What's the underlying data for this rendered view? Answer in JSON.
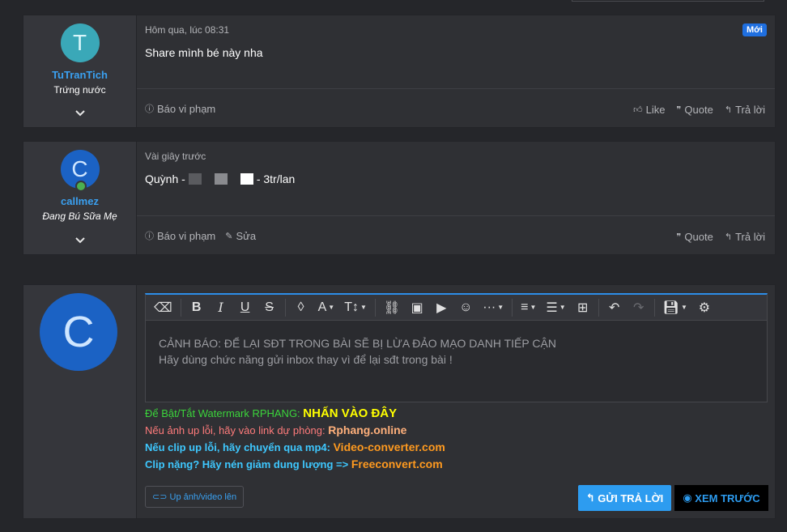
{
  "posts": [
    {
      "avatar_letter": "T",
      "avatar_color": "#3aa8b8",
      "username": "TuTranTich",
      "user_title": "Trứng nước",
      "time": "Hôm qua, lúc 08:31",
      "badge": "Mới",
      "message": "Share mình bé này nha",
      "actions_left": [
        "Báo vi phạm"
      ],
      "actions_right": [
        "Like",
        "Quote",
        "Trả lời"
      ]
    },
    {
      "avatar_letter": "C",
      "avatar_color": "#1b62c4",
      "username": "callmez",
      "user_title": "Đang Bú Sữa Mẹ",
      "time": "Vài giây trước",
      "message_prefix": "Quỳnh -",
      "message_suffix": "- 3tr/lan",
      "actions_left": [
        "Báo vi phạm",
        "Sửa"
      ],
      "actions_right": [
        "Quote",
        "Trả lời"
      ]
    }
  ],
  "reply": {
    "avatar_letter": "C",
    "editor_placeholder_line1": "CẢNH BÁO: ĐỂ LẠI SĐT TRONG BÀI SẼ BỊ LỪA ĐẢO MẠO DANH TIẾP CẬN",
    "editor_placeholder_line2": "Hãy dùng chức năng gửi inbox thay vì để lại sđt trong bài !",
    "notes": [
      {
        "text": "Để Bật/Tắt Watermark RPHANG: ",
        "link": "NHẤN VÀO ĐÂY",
        "color": "#3bd43b",
        "link_color": "#ffff00"
      },
      {
        "text": "Nếu ảnh up lỗi, hãy vào link dự phòng: ",
        "link": "Rphang.online",
        "color": "#ff7b7b",
        "link_color": "#ffb07b"
      },
      {
        "text": "Nếu clip up lỗi, hãy chuyển qua mp4: ",
        "link": "Video-converter.com",
        "color": "#3ec8ff",
        "link_color": "#ff9a1f"
      },
      {
        "text": "Clip nặng? Hãy nén giảm dung lượng => ",
        "link": "Freeconvert.com",
        "color": "#3ec8ff",
        "link_color": "#ff9a1f"
      }
    ],
    "upload_label": "Up ảnh/video lên",
    "send_label": "GỬI TRẢ LỜI",
    "preview_label": "XEM TRƯỚC"
  }
}
